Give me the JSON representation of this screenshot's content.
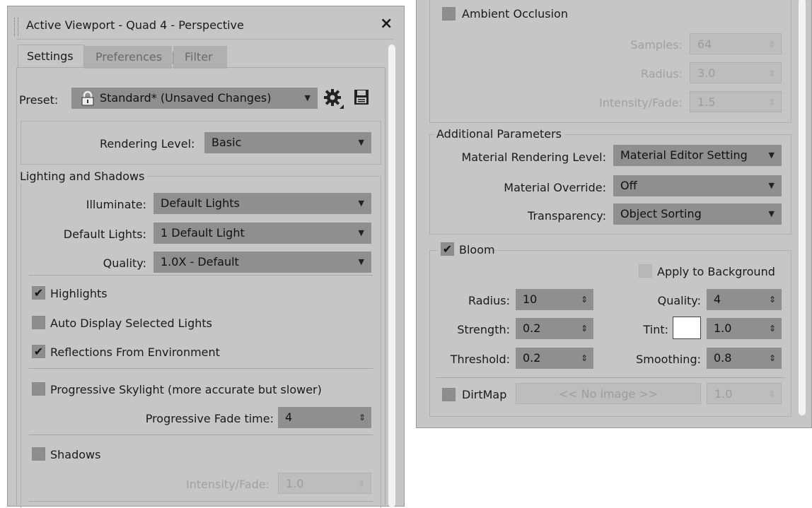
{
  "left": {
    "title": "Active Viewport - Quad 4 - Perspective",
    "close": "×",
    "tabs": [
      "Settings",
      "Preferences",
      "Filter"
    ],
    "preset_label": "Preset:",
    "preset_value": "Standard* (Unsaved Changes)",
    "rendering_level_label": "Rendering Level:",
    "rendering_level_value": "Basic",
    "lighting_group": "Lighting and Shadows",
    "illuminate_label": "Illuminate:",
    "illuminate_value": "Default Lights",
    "default_lights_label": "Default Lights:",
    "default_lights_value": "1 Default Light",
    "quality_label": "Quality:",
    "quality_value": "1.0X - Default",
    "highlights": {
      "label": "Highlights",
      "checked": true
    },
    "auto_display": {
      "label": "Auto Display Selected Lights",
      "checked": false
    },
    "reflections": {
      "label": "Reflections From Environment",
      "checked": true
    },
    "progressive_skylight": {
      "label": "Progressive Skylight (more accurate but slower)",
      "checked": false
    },
    "progressive_fade_label": "Progressive Fade time:",
    "progressive_fade_value": "4",
    "shadows": {
      "label": "Shadows",
      "checked": false
    },
    "shadow_intensity_label": "Intensity/Fade:",
    "shadow_intensity_value": "1.0"
  },
  "right": {
    "ambient_occlusion": {
      "label": "Ambient Occlusion",
      "checked": false
    },
    "samples_label": "Samples:",
    "samples_value": "64",
    "radius_label": "Radius:",
    "radius_value": "3.0",
    "intensity_label": "Intensity/Fade:",
    "intensity_value": "1.5",
    "additional_group": "Additional Parameters",
    "material_rendering_label": "Material Rendering Level:",
    "material_rendering_value": "Material Editor Setting",
    "material_override_label": "Material Override:",
    "material_override_value": "Off",
    "transparency_label": "Transparency:",
    "transparency_value": "Object Sorting",
    "bloom": {
      "label": "Bloom",
      "checked": true
    },
    "apply_background": {
      "label": "Apply to Background",
      "checked": false
    },
    "bloom_radius_label": "Radius:",
    "bloom_radius_value": "10",
    "bloom_quality_label": "Quality:",
    "bloom_quality_value": "4",
    "strength_label": "Strength:",
    "strength_value": "0.2",
    "tint_label": "Tint:",
    "tint_value": "1.0",
    "threshold_label": "Threshold:",
    "threshold_value": "0.2",
    "smoothing_label": "Smoothing:",
    "smoothing_value": "0.8",
    "dirtmap": {
      "label": "DirtMap",
      "checked": false
    },
    "dirtmap_image": "<< No image >>",
    "dirtmap_value": "1.0"
  },
  "icons": {
    "dropdown": "▼",
    "spinner": "⇕",
    "check": "✔",
    "lock": "lock-icon",
    "gear": "gear-icon",
    "save": "save-icon"
  },
  "colors": {
    "panel": "#c6c6c6",
    "field": "#8f8f8f",
    "disabled_text": "#a0a0a0"
  }
}
